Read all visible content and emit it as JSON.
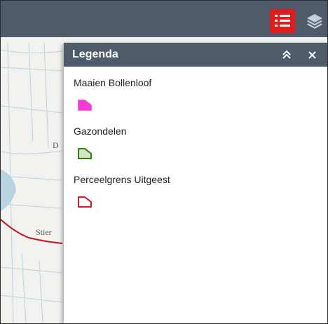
{
  "map": {
    "labels": [
      "D",
      "Stier"
    ],
    "colors": {
      "background": "#f2f2ef",
      "water": "#b9d3e3",
      "road": "#c0171e"
    }
  },
  "toolbar": {
    "legend_button_icon": "list-icon",
    "layers_button_icon": "layers-icon",
    "colors": {
      "bar": "#4f5a6b",
      "active": "#e31b1b"
    }
  },
  "legend": {
    "title": "Legenda",
    "collapse_icon": "double-chevron-up-icon",
    "close_icon": "close-icon",
    "collapse_symbol": "»",
    "close_symbol": "✕",
    "items": [
      {
        "label": "Maaien Bollenloof",
        "fill": "#f23bd2",
        "stroke": "#f23bd2"
      },
      {
        "label": "Gazondelen",
        "fill": "#d3e5c2",
        "stroke": "#2f7d18"
      },
      {
        "label": "Perceelgrens Uitgeest",
        "fill": "#ffffff",
        "stroke": "#d01a20"
      }
    ]
  }
}
